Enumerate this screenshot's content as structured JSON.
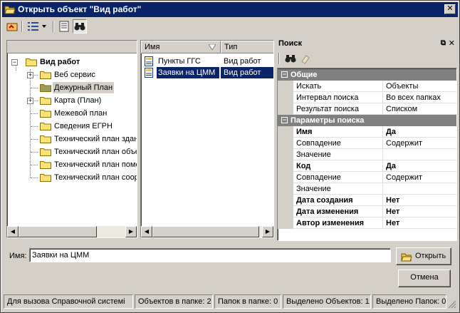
{
  "window": {
    "title": "Открыть объект \"Вид работ\"",
    "close_label": "✕"
  },
  "toolbar": {
    "icons": [
      "up-folder-icon",
      "view-list-icon",
      "properties-icon",
      "search-binoculars-icon"
    ]
  },
  "tree": {
    "root_label": "Вид работ",
    "items": [
      {
        "label": "Веб сервис",
        "expandable": true,
        "selected": false
      },
      {
        "label": "Дежурный План",
        "expandable": false,
        "selected": true
      },
      {
        "label": "Карта (План)",
        "expandable": true,
        "selected": false
      },
      {
        "label": "Межевой план",
        "expandable": false,
        "selected": false
      },
      {
        "label": "Сведения ЕГРН",
        "expandable": false,
        "selected": false
      },
      {
        "label": "Технический план здан",
        "expandable": false,
        "selected": false
      },
      {
        "label": "Технический план объе",
        "expandable": false,
        "selected": false
      },
      {
        "label": "Технический план поме",
        "expandable": false,
        "selected": false
      },
      {
        "label": "Технический план соор",
        "expandable": false,
        "selected": false
      }
    ]
  },
  "list": {
    "columns": [
      "Имя",
      "Тип"
    ],
    "rows": [
      {
        "name": "Пункты ГГС",
        "type": "Вид работ",
        "selected": false
      },
      {
        "name": "Заявки на ЦММ",
        "type": "Вид работ",
        "selected": true
      }
    ]
  },
  "search_panel": {
    "title": "Поиск",
    "categories": [
      {
        "label": "Общие",
        "rows": [
          {
            "key": "Искать",
            "value": "Объекты",
            "bold": false
          },
          {
            "key": "Интервал поиска",
            "value": "Во всех папках",
            "bold": false
          },
          {
            "key": "Результат поиска",
            "value": "Списком",
            "bold": false
          }
        ]
      },
      {
        "label": "Параметры поиска",
        "rows": [
          {
            "key": "Имя",
            "value": "Да",
            "bold": true
          },
          {
            "key": "Совпадение",
            "value": "Содержит",
            "bold": false
          },
          {
            "key": "Значение",
            "value": "",
            "bold": false
          },
          {
            "key": "Код",
            "value": "Да",
            "bold": true
          },
          {
            "key": "Совпадение",
            "value": "Содержит",
            "bold": false
          },
          {
            "key": "Значение",
            "value": "",
            "bold": false
          },
          {
            "key": "Дата создания",
            "value": "Нет",
            "bold": true
          },
          {
            "key": "Дата изменения",
            "value": "Нет",
            "bold": true
          },
          {
            "key": "Автор изменения",
            "value": "Нет",
            "bold": true
          }
        ]
      }
    ]
  },
  "name_field": {
    "label": "Имя:",
    "value": "Заявки на ЦММ"
  },
  "buttons": {
    "open": "Открыть",
    "cancel": "Отмена"
  },
  "status": [
    "Для вызова Справочной системі",
    "Объектов в папке: 2",
    "Папок в папке: 0",
    "Выделено Объектов: 1",
    "Выделено Папок: 0"
  ],
  "colors": {
    "title_bar": "#0a246a",
    "selection": "#0a246a",
    "folder": "#f8e27a",
    "category_bg": "#808080"
  }
}
